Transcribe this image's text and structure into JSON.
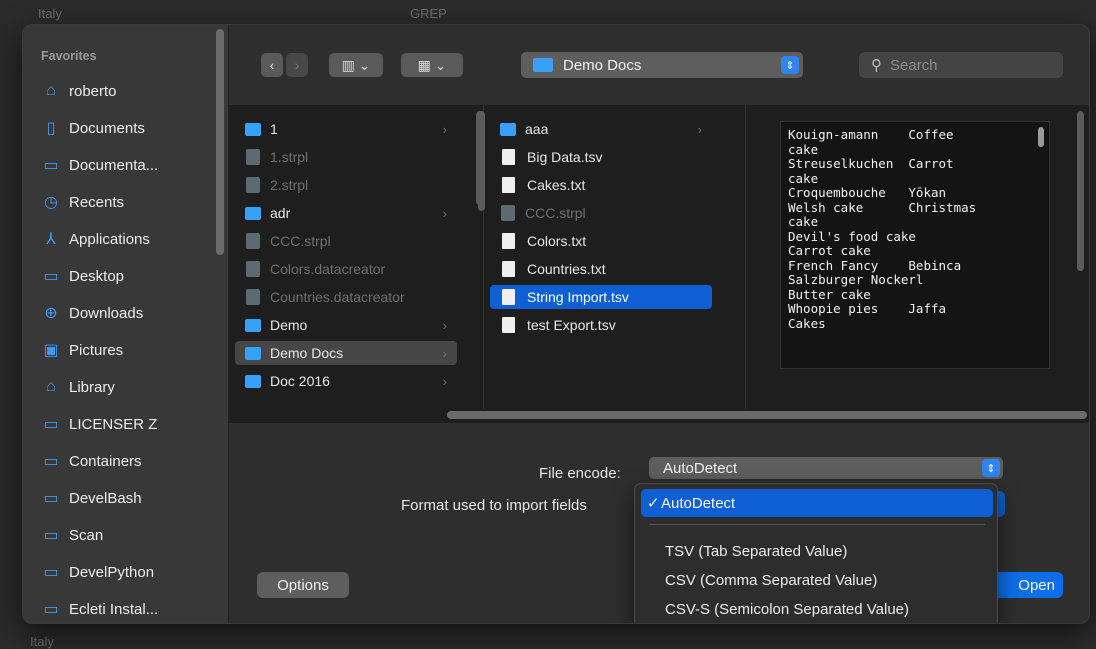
{
  "background": {
    "top_texts": [
      "Italy",
      "GREP"
    ],
    "bottom_texts": [
      "Italy"
    ]
  },
  "sidebar": {
    "heading": "Favorites",
    "items": [
      {
        "label": "roberto",
        "icon": "home-icon"
      },
      {
        "label": "Documents",
        "icon": "document-icon"
      },
      {
        "label": "Documenta...",
        "icon": "folder-icon"
      },
      {
        "label": "Recents",
        "icon": "clock-icon"
      },
      {
        "label": "Applications",
        "icon": "applications-icon"
      },
      {
        "label": "Desktop",
        "icon": "desktop-icon"
      },
      {
        "label": "Downloads",
        "icon": "download-icon"
      },
      {
        "label": "Pictures",
        "icon": "pictures-icon"
      },
      {
        "label": "Library",
        "icon": "library-icon"
      },
      {
        "label": "LICENSER Z",
        "icon": "folder-icon"
      },
      {
        "label": "Containers",
        "icon": "folder-icon"
      },
      {
        "label": "DevelBash",
        "icon": "folder-icon"
      },
      {
        "label": "Scan",
        "icon": "folder-icon"
      },
      {
        "label": "DevelPython",
        "icon": "folder-icon"
      },
      {
        "label": "Ecleti Instal...",
        "icon": "folder-icon"
      }
    ]
  },
  "toolbar": {
    "location": "Demo Docs",
    "search_placeholder": "Search"
  },
  "column1": [
    {
      "name": "1",
      "type": "folder",
      "chevron": true
    },
    {
      "name": "1.strpl",
      "type": "strpl",
      "dim": true
    },
    {
      "name": "2.strpl",
      "type": "strpl",
      "dim": true
    },
    {
      "name": "adr",
      "type": "folder",
      "chevron": true
    },
    {
      "name": "CCC.strpl",
      "type": "strpl",
      "dim": true
    },
    {
      "name": "Colors.datacreator",
      "type": "strpl",
      "dim": true
    },
    {
      "name": "Countries.datacreator",
      "type": "strpl",
      "dim": true
    },
    {
      "name": "Demo",
      "type": "folder",
      "chevron": true
    },
    {
      "name": "Demo Docs",
      "type": "folder",
      "chevron": true,
      "selected": true
    },
    {
      "name": "Doc 2016",
      "type": "folder",
      "chevron": true
    }
  ],
  "column2": [
    {
      "name": "aaa",
      "type": "folder",
      "chevron": true
    },
    {
      "name": "Big Data.tsv",
      "type": "doc"
    },
    {
      "name": "Cakes.txt",
      "type": "doc"
    },
    {
      "name": "CCC.strpl",
      "type": "strpl",
      "dim": true
    },
    {
      "name": "Colors.txt",
      "type": "doc"
    },
    {
      "name": "Countries.txt",
      "type": "doc"
    },
    {
      "name": "String Import.tsv",
      "type": "doc",
      "selected": true
    },
    {
      "name": "test Export.tsv",
      "type": "doc"
    }
  ],
  "preview_text": "Kouign-amann    Coffee\ncake\nStreuselkuchen  Carrot\ncake\nCroquembouche   Yōkan\nWelsh cake      Christmas\ncake\nDevil's food cake\nCarrot cake\nFrench Fancy    Bebinca\nSalzburger Nockerl\nButter cake\nWhoopie pies    Jaffa\nCakes",
  "options": {
    "file_encode_label": "File encode:",
    "file_encode_value": "AutoDetect",
    "format_label": "Format used to import fields",
    "options_button": "Options",
    "open_button": "Open"
  },
  "format_menu": {
    "selected": "AutoDetect",
    "items": [
      "TSV (Tab Separated Value)",
      "CSV  (Comma Separated Value)",
      "CSV-S  (Semicolon Separated Value)"
    ]
  },
  "colors": {
    "accent": "#0d5fd3",
    "folder": "#39a0f7"
  }
}
